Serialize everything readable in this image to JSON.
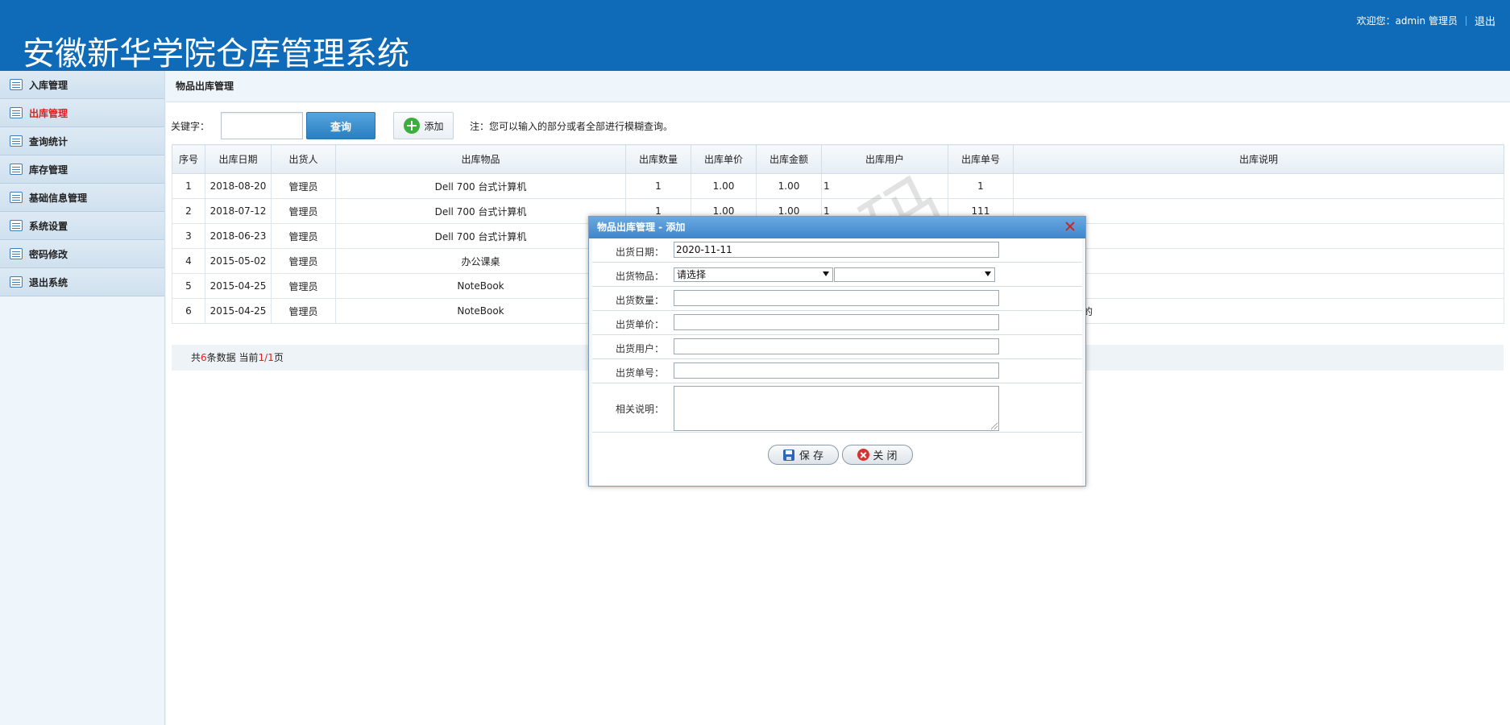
{
  "header": {
    "title": "安徽新华学院仓库管理系统",
    "welcome": "欢迎您：admin 管理员",
    "logout": "退出"
  },
  "sidebar": {
    "items": [
      {
        "label": "入库管理",
        "active": false
      },
      {
        "label": "出库管理",
        "active": true
      },
      {
        "label": "查询统计",
        "active": false
      },
      {
        "label": "库存管理",
        "active": false
      },
      {
        "label": "基础信息管理",
        "active": false
      },
      {
        "label": "系统设置",
        "active": false
      },
      {
        "label": "密码修改",
        "active": false
      },
      {
        "label": "退出系统",
        "active": false
      }
    ]
  },
  "panel": {
    "title": "物品出库管理",
    "keyword_label": "关键字：",
    "keyword_value": "",
    "search_label": "查询",
    "add_label": "添加",
    "hint": "注：您可以输入的部分或者全部进行模糊查询。"
  },
  "table": {
    "headers": [
      "序号",
      "出库日期",
      "出货人",
      "出库物品",
      "出库数量",
      "出库单价",
      "出库金额",
      "出库用户",
      "出库单号",
      "出库说明"
    ],
    "rows": [
      [
        "1",
        "2018-08-20",
        "管理员",
        "Dell 700 台式计算机",
        "1",
        "1.00",
        "1.00",
        "1",
        "1",
        ""
      ],
      [
        "2",
        "2018-07-12",
        "管理员",
        "Dell 700 台式计算机",
        "1",
        "1.00",
        "1.00",
        "1",
        "111",
        ""
      ],
      [
        "3",
        "2018-06-23",
        "管理员",
        "Dell 700 台式计算机",
        "",
        "",
        "",
        "",
        "",
        ""
      ],
      [
        "4",
        "2015-05-02",
        "管理员",
        "办公课桌",
        "",
        "",
        "",
        "",
        "",
        ""
      ],
      [
        "5",
        "2015-04-25",
        "管理员",
        "NoteBook",
        "",
        "",
        "",
        "",
        "",
        ""
      ],
      [
        "6",
        "2015-04-25",
        "管理员",
        "NoteBook",
        "",
        "",
        "",
        "",
        "",
        "过申通快递发送的"
      ]
    ]
  },
  "pager": {
    "prefix": "共",
    "count": "6",
    "mid": "条数据 当前",
    "current": "1",
    "slash": "/",
    "total": "1",
    "suffix": "页"
  },
  "watermark": "小环源码",
  "dialog": {
    "title": "物品出库管理 - 添加",
    "fields": {
      "date_label": "出货日期：",
      "date_value": "2020-11-11",
      "item_label": "出货物品：",
      "item_select": "请选择",
      "item_select2": "",
      "qty_label": "出货数量：",
      "qty_value": "",
      "price_label": "出货单价：",
      "price_value": "",
      "user_label": "出货用户：",
      "user_value": "",
      "no_label": "出货单号：",
      "no_value": "",
      "note_label": "相关说明：",
      "note_value": ""
    },
    "save_label": "保 存",
    "close_label": "关 闭"
  }
}
